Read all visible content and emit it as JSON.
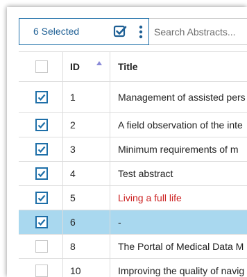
{
  "toolbar": {
    "selected_label": "6 Selected",
    "search_placeholder": "Search Abstracts..."
  },
  "table": {
    "columns": [
      "ID",
      "Title"
    ],
    "rows": [
      {
        "id": "1",
        "title": "Management of assisted pers",
        "checked": true
      },
      {
        "id": "2",
        "title": "A field observation of the inte",
        "checked": true
      },
      {
        "id": "3",
        "title": "Minimum requirements of m",
        "checked": true
      },
      {
        "id": "4",
        "title": "Test abstract",
        "checked": true
      },
      {
        "id": "5",
        "title": "Living a full life",
        "checked": true
      },
      {
        "id": "6",
        "title": "-",
        "checked": true
      },
      {
        "id": "8",
        "title": "The Portal of Medical Data M",
        "checked": false
      },
      {
        "id": "10",
        "title": "Improving the quality of navig",
        "checked": false
      }
    ]
  },
  "colors": {
    "accent": "#1e6fa8",
    "active_row": "#a9d8ef",
    "highlight_text": "#cc2020"
  }
}
